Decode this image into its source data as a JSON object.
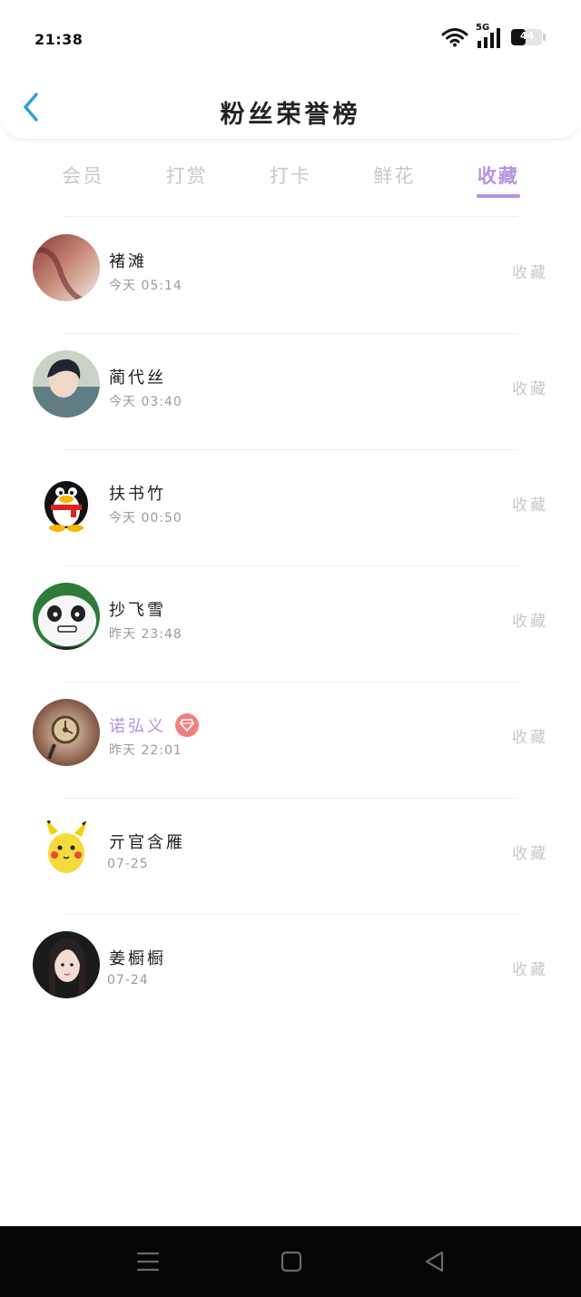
{
  "status_bar": {
    "time": "21:38",
    "network": "5G",
    "battery": "44"
  },
  "header": {
    "title": "粉丝荣誉榜",
    "back_icon": "chevron-left-icon"
  },
  "tabs": [
    {
      "label": "会员",
      "active": false
    },
    {
      "label": "打赏",
      "active": false
    },
    {
      "label": "打卡",
      "active": false
    },
    {
      "label": "鲜花",
      "active": false
    },
    {
      "label": "收藏",
      "active": true
    }
  ],
  "fans": [
    {
      "name": "褚滩",
      "time": "今天 05:14",
      "action": "收藏"
    },
    {
      "name": "蔺代丝",
      "time": "今天 03:40",
      "action": "收藏"
    },
    {
      "name": "扶书竹",
      "time": "今天 00:50",
      "action": "收藏"
    },
    {
      "name": "抄飞雪",
      "time": "昨天 23:48",
      "action": "收藏"
    },
    {
      "name": "诺弘义",
      "time": "昨天 22:01",
      "action": "收藏",
      "vip": true
    },
    {
      "name": "亓官含雁",
      "time": "07-25",
      "action": "收藏"
    },
    {
      "name": "姜橱橱",
      "time": "07-24",
      "action": "收藏"
    }
  ],
  "colors": {
    "accent": "#b793e0",
    "back_arrow": "#2d9cdb",
    "badge": "#f08080",
    "muted": "#c8c8c8"
  }
}
